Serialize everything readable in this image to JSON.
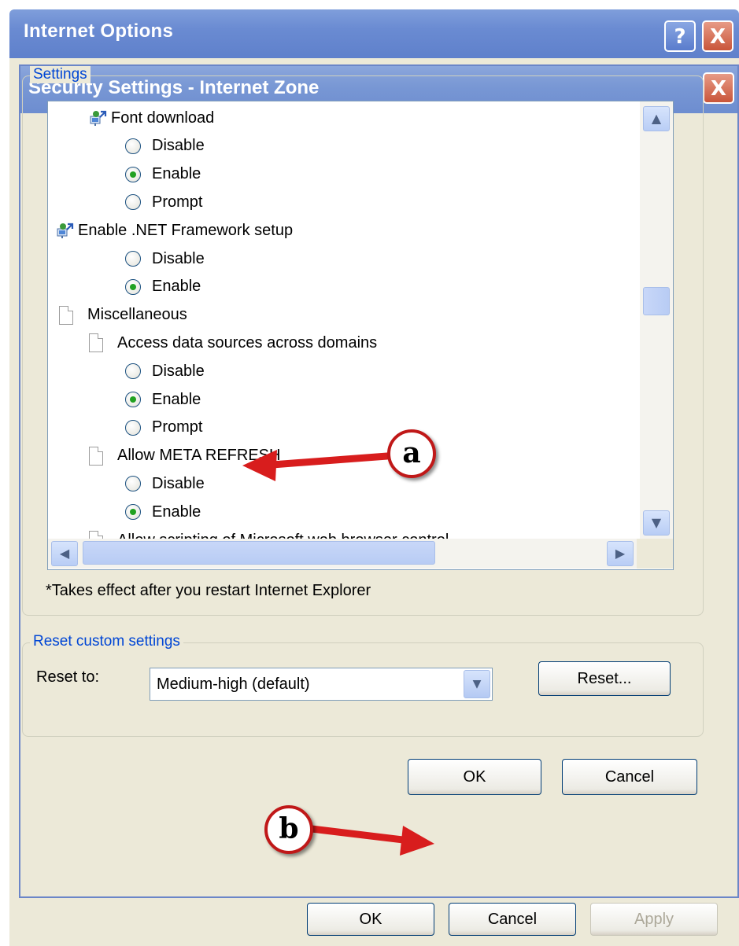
{
  "outer_window": {
    "title": "Internet Options",
    "help_label": "?",
    "close_label": "X",
    "buttons": {
      "ok": "OK",
      "cancel": "Cancel",
      "apply": "Apply"
    }
  },
  "dialog": {
    "title": "Security Settings - Internet Zone",
    "close_label": "X",
    "settings_group_label": "Settings",
    "tree": [
      {
        "type": "setting",
        "label": "Font download",
        "icon": "network-setting-icon"
      },
      {
        "type": "option",
        "label": "Disable",
        "selected": false
      },
      {
        "type": "option",
        "label": "Enable",
        "selected": true
      },
      {
        "type": "option",
        "label": "Prompt",
        "selected": false
      },
      {
        "type": "setting",
        "label": "Enable .NET Framework setup",
        "icon": "network-setting-icon"
      },
      {
        "type": "option",
        "label": "Disable",
        "selected": false
      },
      {
        "type": "option",
        "label": "Enable",
        "selected": true
      },
      {
        "type": "category",
        "label": "Miscellaneous",
        "icon": "document-icon"
      },
      {
        "type": "setting",
        "label": "Access data sources across domains",
        "icon": "document-icon"
      },
      {
        "type": "option",
        "label": "Disable",
        "selected": false
      },
      {
        "type": "option",
        "label": "Enable",
        "selected": true
      },
      {
        "type": "option",
        "label": "Prompt",
        "selected": false
      },
      {
        "type": "setting",
        "label": "Allow META REFRESH",
        "icon": "document-icon"
      },
      {
        "type": "option",
        "label": "Disable",
        "selected": false
      },
      {
        "type": "option",
        "label": "Enable",
        "selected": true
      },
      {
        "type": "setting",
        "label": "Allow scripting of Microsoft web browser control",
        "icon": "document-icon"
      }
    ],
    "restart_note": "*Takes effect after you restart Internet Explorer",
    "reset_group_label": "Reset custom settings",
    "reset_to_label": "Reset to:",
    "reset_to_value": "Medium-high (default)",
    "reset_button": "Reset...",
    "ok_button": "OK",
    "cancel_button": "Cancel"
  },
  "annotations": {
    "a": "a",
    "b": "b",
    "color": "#d81d1d"
  },
  "colors": {
    "titlebar": "#6d8dd0",
    "dialog_bg": "#ece9d8",
    "group_label": "#0046d5",
    "radio_selected": "#21a121"
  }
}
